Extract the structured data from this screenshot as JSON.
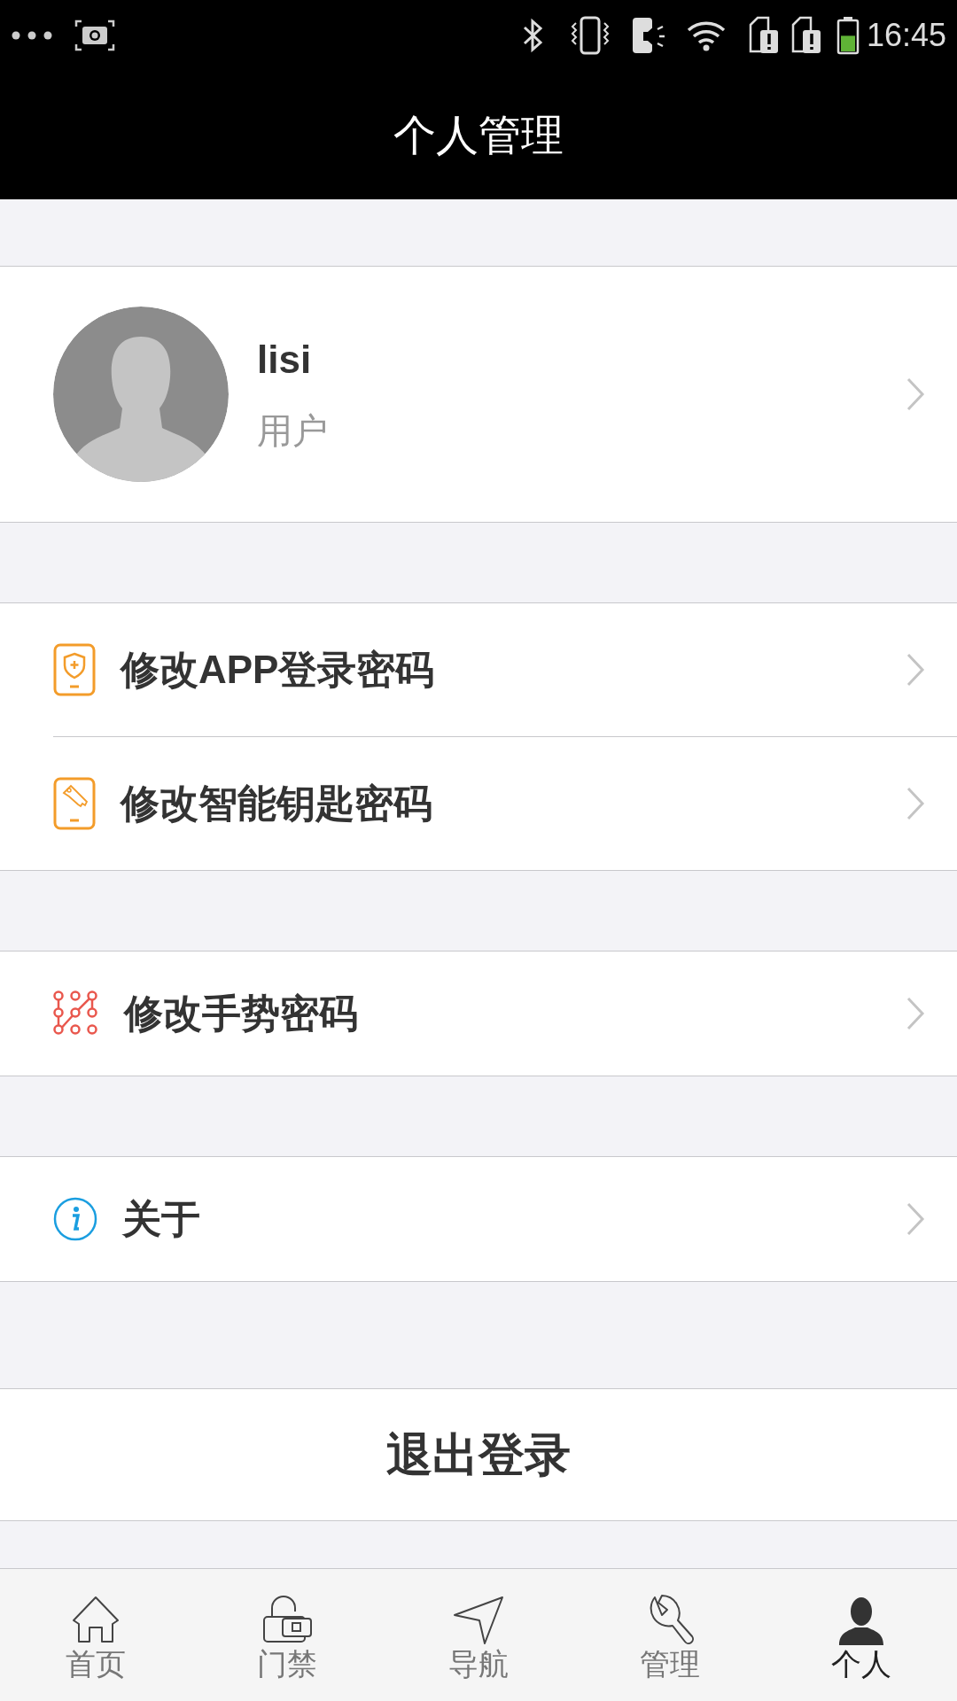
{
  "status_bar": {
    "time": "16:45"
  },
  "header": {
    "title": "个人管理"
  },
  "profile": {
    "name": "lisi",
    "role": "用户"
  },
  "menu_groups": [
    {
      "items": [
        {
          "label": "修改APP登录密码"
        },
        {
          "label": "修改智能钥匙密码"
        }
      ]
    },
    {
      "items": [
        {
          "label": "修改手势密码"
        }
      ]
    },
    {
      "items": [
        {
          "label": "关于"
        }
      ]
    }
  ],
  "logout_button": {
    "label": "退出登录"
  },
  "bottom_nav": [
    {
      "label": "首页",
      "selected": false
    },
    {
      "label": "门禁",
      "selected": false
    },
    {
      "label": "导航",
      "selected": false
    },
    {
      "label": "管理",
      "selected": false
    },
    {
      "label": "个人",
      "selected": true
    }
  ]
}
